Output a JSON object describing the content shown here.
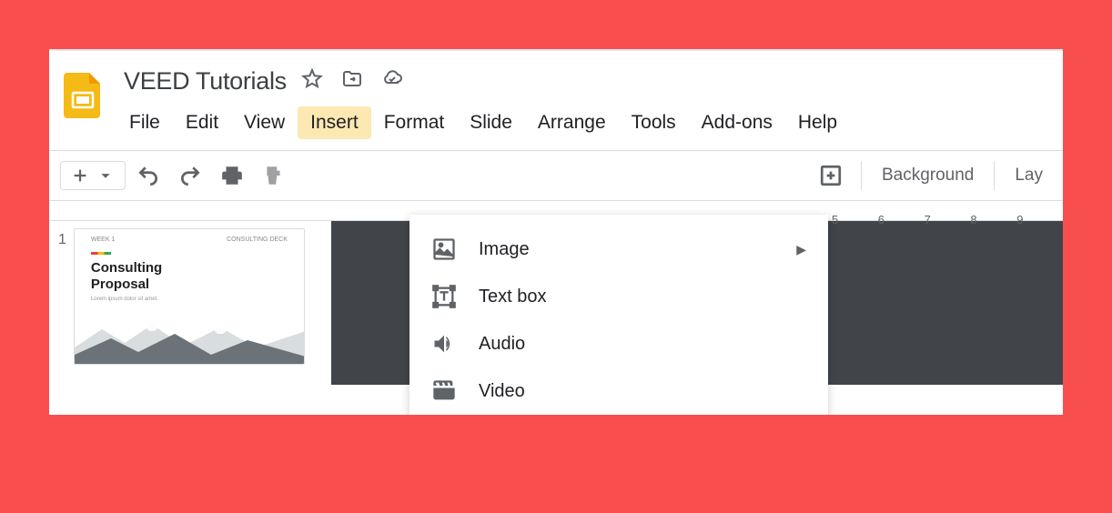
{
  "document": {
    "title": "VEED Tutorials"
  },
  "menubar": {
    "items": [
      {
        "label": "File",
        "active": false
      },
      {
        "label": "Edit",
        "active": false
      },
      {
        "label": "View",
        "active": false
      },
      {
        "label": "Insert",
        "active": true
      },
      {
        "label": "Format",
        "active": false
      },
      {
        "label": "Slide",
        "active": false
      },
      {
        "label": "Arrange",
        "active": false
      },
      {
        "label": "Tools",
        "active": false
      },
      {
        "label": "Add-ons",
        "active": false
      },
      {
        "label": "Help",
        "active": false
      }
    ]
  },
  "toolbar": {
    "background_label": "Background",
    "layout_label": "Lay"
  },
  "ruler": {
    "ticks": [
      "5",
      "6",
      "7",
      "8",
      "9"
    ]
  },
  "thumbnail": {
    "number": "1",
    "header_left": "WEEK 1",
    "header_right": "CONSULTING DECK",
    "title_line1": "Consulting",
    "title_line2": "Proposal",
    "lorem": "Lorem ipsum dolor sit amet."
  },
  "dropdown": {
    "items": [
      {
        "label": "Image",
        "icon": "image",
        "has_submenu": true
      },
      {
        "label": "Text box",
        "icon": "textbox",
        "has_submenu": false
      },
      {
        "label": "Audio",
        "icon": "audio",
        "has_submenu": false
      },
      {
        "label": "Video",
        "icon": "video",
        "has_submenu": false
      }
    ]
  }
}
